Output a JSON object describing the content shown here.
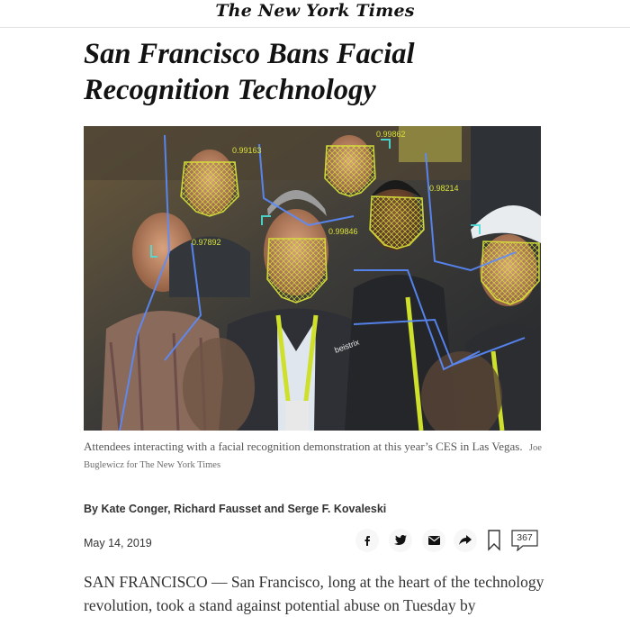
{
  "masthead": {
    "logo_text": "The New York Times"
  },
  "article": {
    "headline": "San Francisco Bans Facial Recognition Technology",
    "image": {
      "caption": "Attendees interacting with a facial recognition demonstration at this year’s CES in Las Vegas.",
      "credit": "Joe Buglewicz for The New York Times",
      "overlay_labels": [
        "0.99163",
        "0.99846",
        "0.99862",
        "0.97892",
        "0.98214"
      ],
      "badge_text": "beistrix"
    },
    "byline": {
      "prefix": "By",
      "authors": "Kate Conger, Richard Fausset and Serge F. Kovaleski"
    },
    "date": "May 14, 2019",
    "share_icons": [
      "facebook-icon",
      "twitter-icon",
      "email-icon",
      "share-arrow-icon",
      "bookmark-icon",
      "comment-icon"
    ],
    "comment_count": "367",
    "lede": "SAN FRANCISCO — San Francisco, long at the heart of the technology revolution, took a stand against potential abuse on Tuesday by"
  },
  "colors": {
    "face_mesh": "#d8e03a",
    "tracking_lines": "#5a8cff",
    "lanyard": "#cfe02c",
    "text": "#121212"
  }
}
